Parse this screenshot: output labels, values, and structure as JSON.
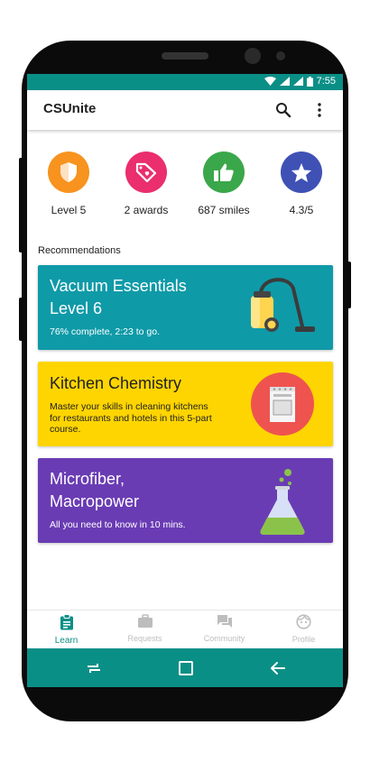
{
  "status_bar": {
    "time": "7:55",
    "color": "#0a8f86"
  },
  "app_bar": {
    "title": "CSUnite",
    "icons": [
      "search-icon",
      "more-vert-icon"
    ]
  },
  "stats": [
    {
      "icon": "shield-icon",
      "label": "Level 5",
      "color": "#f7931e"
    },
    {
      "icon": "tag-heart-icon",
      "label": "2 awards",
      "color": "#ea2e6e"
    },
    {
      "icon": "thumbs-up-icon",
      "label": "687 smiles",
      "color": "#3aa74a"
    },
    {
      "icon": "star-icon",
      "label": "4.3/5",
      "color": "#3f51b5"
    }
  ],
  "recommendations": {
    "heading": "Recommendations",
    "cards": [
      {
        "title_line1": "Vacuum Essentials",
        "title_line2": "Level 6",
        "subtitle": "76% complete, 2:23 to go.",
        "color": "#0f9aa8",
        "icon": "vacuum-icon",
        "progress_percent": 76
      },
      {
        "title_line1": "Kitchen Chemistry",
        "title_line2": "",
        "subtitle": "Master your skills in cleaning kitchens for restaurants and hotels in this 5-part course.",
        "color": "#fed501",
        "icon": "stove-icon"
      },
      {
        "title_line1": "Microfiber,",
        "title_line2": "Macropower",
        "subtitle": "All you need to know in 10 mins.",
        "color": "#6a3cb4",
        "icon": "flask-icon"
      }
    ]
  },
  "bottom_nav": [
    {
      "label": "Learn",
      "icon": "clipboard-icon",
      "active": true
    },
    {
      "label": "Requests",
      "icon": "briefcase-icon",
      "active": false
    },
    {
      "label": "Community",
      "icon": "chat-icon",
      "active": false
    },
    {
      "label": "Profile",
      "icon": "face-icon",
      "active": false
    }
  ],
  "accent_color": "#0a8f86"
}
